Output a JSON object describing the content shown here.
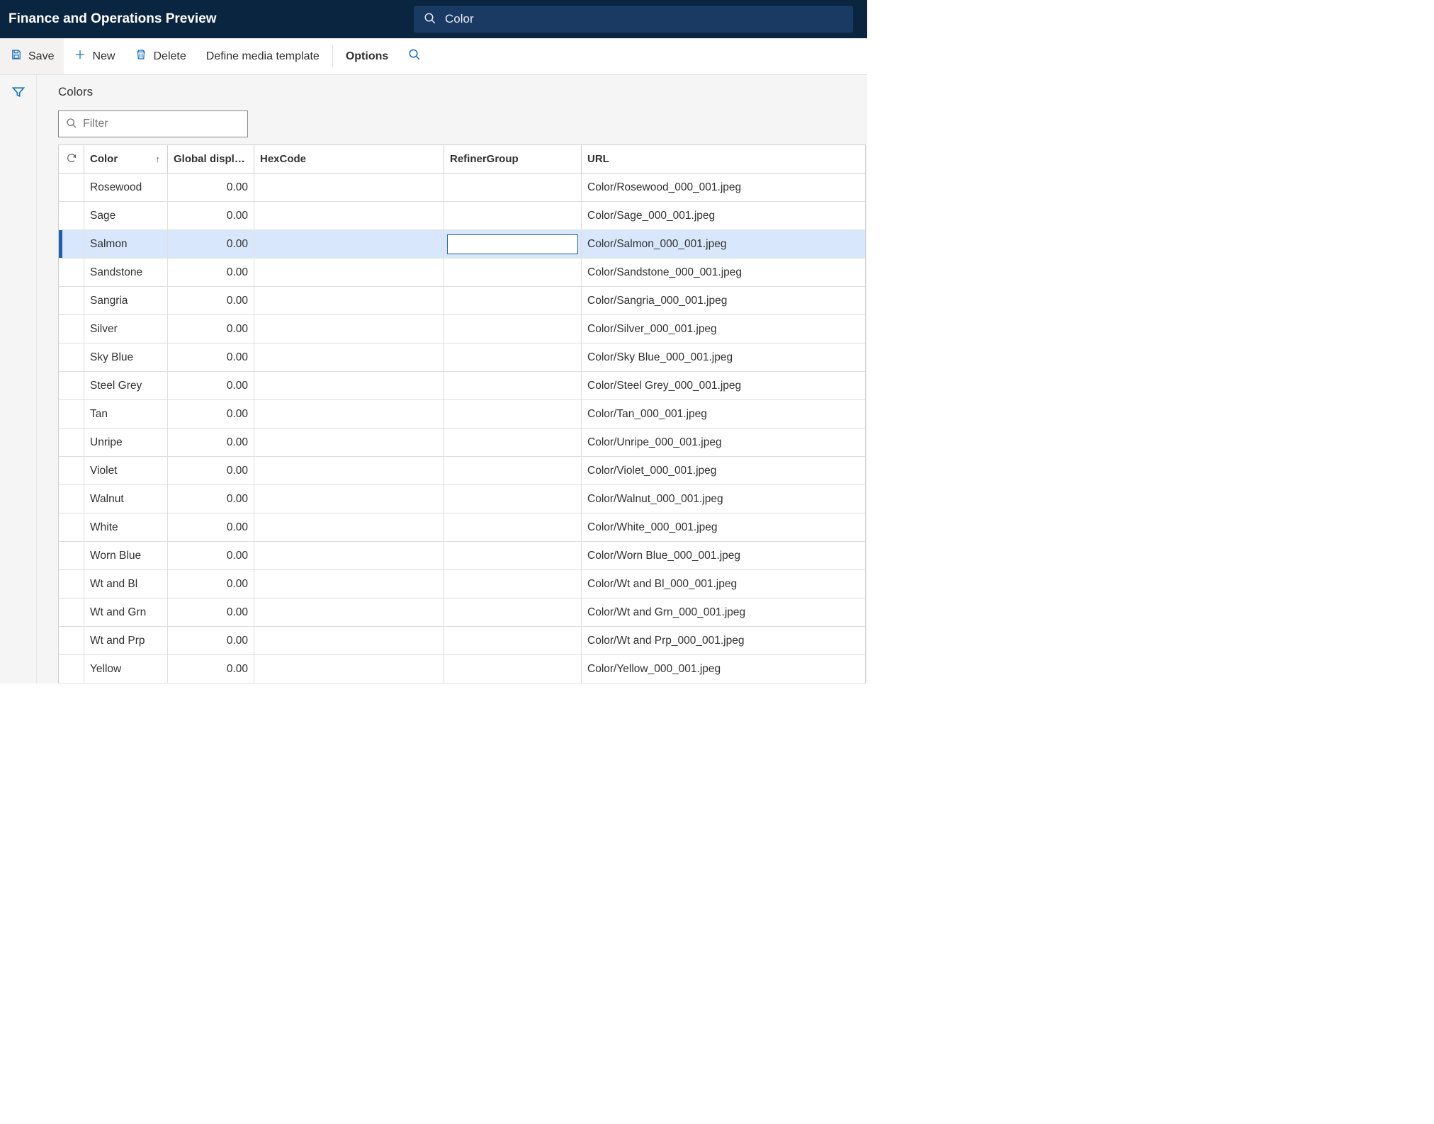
{
  "header": {
    "app_title": "Finance and Operations Preview",
    "search_value": "Color"
  },
  "commands": {
    "save": "Save",
    "new": "New",
    "delete": "Delete",
    "define_media": "Define media template",
    "options": "Options"
  },
  "page": {
    "heading": "Colors",
    "filter_placeholder": "Filter"
  },
  "grid": {
    "columns": {
      "color": "Color",
      "gdo": "Global display …",
      "hex": "HexCode",
      "refiner": "RefinerGroup",
      "url": "URL"
    },
    "selected_index": 2,
    "rows": [
      {
        "color": "Rosewood",
        "gdo": "0.00",
        "hex": "",
        "refiner": "",
        "url": "Color/Rosewood_000_001.jpeg"
      },
      {
        "color": "Sage",
        "gdo": "0.00",
        "hex": "",
        "refiner": "",
        "url": "Color/Sage_000_001.jpeg"
      },
      {
        "color": "Salmon",
        "gdo": "0.00",
        "hex": "",
        "refiner": "",
        "url": "Color/Salmon_000_001.jpeg"
      },
      {
        "color": "Sandstone",
        "gdo": "0.00",
        "hex": "",
        "refiner": "",
        "url": "Color/Sandstone_000_001.jpeg"
      },
      {
        "color": "Sangria",
        "gdo": "0.00",
        "hex": "",
        "refiner": "",
        "url": "Color/Sangria_000_001.jpeg"
      },
      {
        "color": "Silver",
        "gdo": "0.00",
        "hex": "",
        "refiner": "",
        "url": "Color/Silver_000_001.jpeg"
      },
      {
        "color": "Sky Blue",
        "gdo": "0.00",
        "hex": "",
        "refiner": "",
        "url": "Color/Sky Blue_000_001.jpeg"
      },
      {
        "color": "Steel Grey",
        "gdo": "0.00",
        "hex": "",
        "refiner": "",
        "url": "Color/Steel Grey_000_001.jpeg"
      },
      {
        "color": "Tan",
        "gdo": "0.00",
        "hex": "",
        "refiner": "",
        "url": "Color/Tan_000_001.jpeg"
      },
      {
        "color": "Unripe",
        "gdo": "0.00",
        "hex": "",
        "refiner": "",
        "url": "Color/Unripe_000_001.jpeg"
      },
      {
        "color": "Violet",
        "gdo": "0.00",
        "hex": "",
        "refiner": "",
        "url": "Color/Violet_000_001.jpeg"
      },
      {
        "color": "Walnut",
        "gdo": "0.00",
        "hex": "",
        "refiner": "",
        "url": "Color/Walnut_000_001.jpeg"
      },
      {
        "color": "White",
        "gdo": "0.00",
        "hex": "",
        "refiner": "",
        "url": "Color/White_000_001.jpeg"
      },
      {
        "color": "Worn Blue",
        "gdo": "0.00",
        "hex": "",
        "refiner": "",
        "url": "Color/Worn Blue_000_001.jpeg"
      },
      {
        "color": "Wt and Bl",
        "gdo": "0.00",
        "hex": "",
        "refiner": "",
        "url": "Color/Wt and Bl_000_001.jpeg"
      },
      {
        "color": "Wt and Grn",
        "gdo": "0.00",
        "hex": "",
        "refiner": "",
        "url": "Color/Wt and Grn_000_001.jpeg"
      },
      {
        "color": "Wt and Prp",
        "gdo": "0.00",
        "hex": "",
        "refiner": "",
        "url": "Color/Wt and Prp_000_001.jpeg"
      },
      {
        "color": "Yellow",
        "gdo": "0.00",
        "hex": "",
        "refiner": "",
        "url": "Color/Yellow_000_001.jpeg"
      }
    ]
  }
}
